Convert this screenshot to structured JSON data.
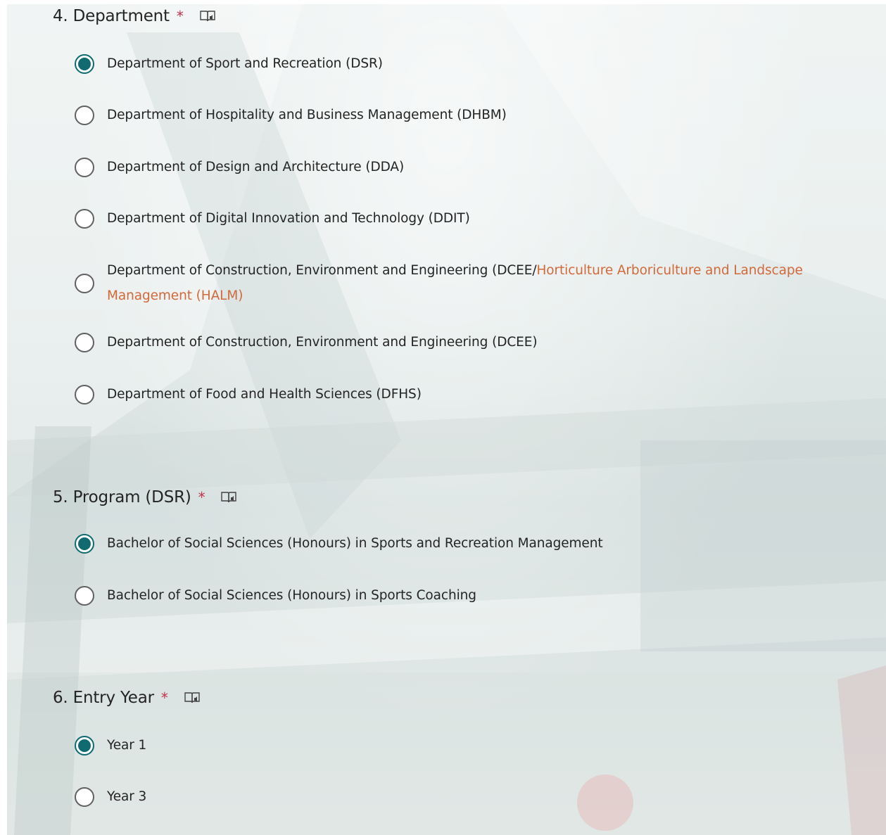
{
  "colors": {
    "accent": "#0f6b70",
    "required": "#c4314b",
    "highlight": "#d2693a",
    "text": "#242424"
  },
  "questions": [
    {
      "number_title": "4. Department",
      "required_mark": "*",
      "reader_icon": "immersive-reader-icon",
      "options": [
        {
          "label": "Department of Sport and Recreation (DSR)",
          "checked": true
        },
        {
          "label": "Department of Hospitality and Business Management (DHBM)",
          "checked": false
        },
        {
          "label": "Department of Design and Architecture (DDA)",
          "checked": false
        },
        {
          "label": "Department of Digital Innovation and Technology (DDIT)",
          "checked": false
        },
        {
          "label_prefix": "Department of Construction, Environment and Engineering (DCEE/",
          "label_highlight_line1": "Horticulture Arboriculture and Landscape",
          "label_highlight_line2": "Management (HALM)",
          "checked": false
        },
        {
          "label": "Department of Construction, Environment and Engineering (DCEE)",
          "checked": false
        },
        {
          "label": "Department of Food and Health Sciences (DFHS)",
          "checked": false
        }
      ]
    },
    {
      "number_title": "5. Program (DSR)",
      "required_mark": "*",
      "reader_icon": "immersive-reader-icon",
      "options": [
        {
          "label": "Bachelor of Social Sciences (Honours) in Sports and Recreation Management",
          "checked": true
        },
        {
          "label": "Bachelor of Social Sciences (Honours) in Sports Coaching",
          "checked": false
        }
      ]
    },
    {
      "number_title": "6. Entry Year",
      "required_mark": "*",
      "reader_icon": "immersive-reader-icon",
      "options": [
        {
          "label": "Year 1",
          "checked": true
        },
        {
          "label": "Year 3",
          "checked": false
        }
      ]
    }
  ]
}
